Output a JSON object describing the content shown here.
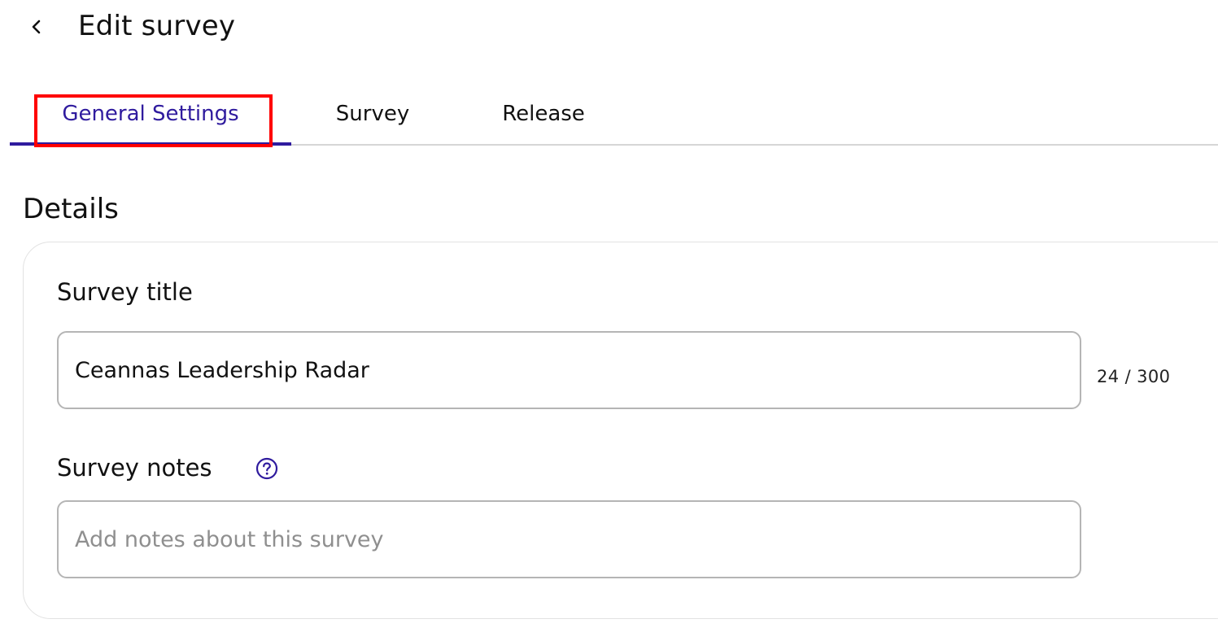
{
  "header": {
    "title": "Edit survey",
    "back_icon": "chevron-left-icon"
  },
  "tabs": [
    {
      "label": "General Settings",
      "active": true
    },
    {
      "label": "Survey",
      "active": false
    },
    {
      "label": "Release",
      "active": false
    }
  ],
  "details": {
    "heading": "Details",
    "survey_title": {
      "label": "Survey title",
      "value": "Ceannas Leadership Radar",
      "char_count": "24 / 300"
    },
    "survey_notes": {
      "label": "Survey notes",
      "help_icon": "question-circle-icon",
      "placeholder": "Add notes about this survey",
      "value": ""
    }
  },
  "colors": {
    "accent": "#2f1b9e",
    "highlight": "#ff0000",
    "border": "#b5b5b5"
  }
}
